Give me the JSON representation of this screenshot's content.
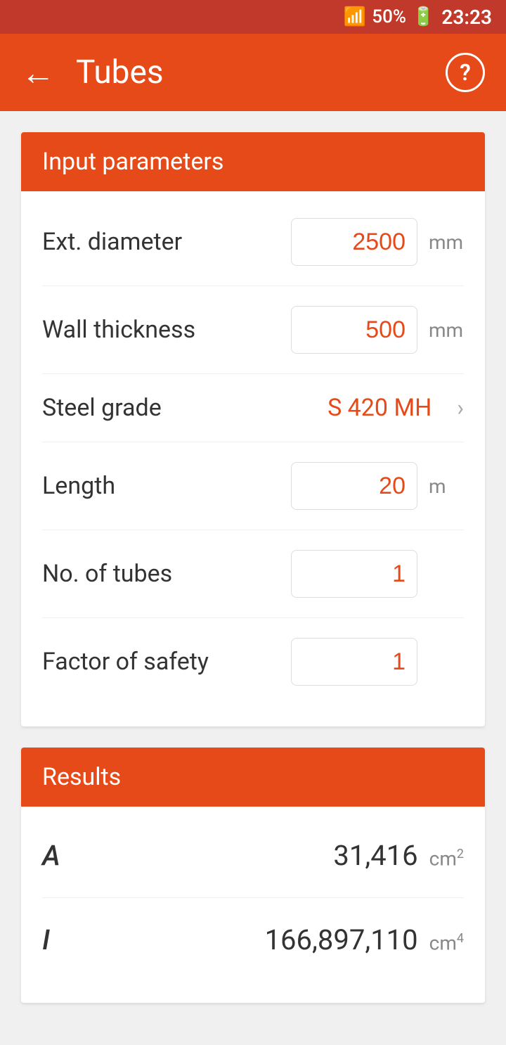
{
  "statusBar": {
    "battery": "50%",
    "time": "23:23",
    "batteryIcon": "🔋",
    "signalIcon": "📶"
  },
  "appBar": {
    "backIcon": "←",
    "title": "Tubes",
    "helpIcon": "?",
    "helpLabel": "?"
  },
  "inputSection": {
    "header": "Input parameters",
    "fields": [
      {
        "label": "Ext. diameter",
        "value": "2500",
        "unit": "mm",
        "type": "input",
        "name": "ext-diameter"
      },
      {
        "label": "Wall thickness",
        "value": "500",
        "unit": "mm",
        "type": "input",
        "name": "wall-thickness"
      },
      {
        "label": "Steel grade",
        "value": "S 420 MH",
        "unit": "",
        "type": "select",
        "name": "steel-grade"
      },
      {
        "label": "Length",
        "value": "20",
        "unit": "m",
        "type": "input",
        "name": "length"
      },
      {
        "label": "No. of tubes",
        "value": "1",
        "unit": "",
        "type": "input",
        "name": "no-of-tubes"
      },
      {
        "label": "Factor of safety",
        "value": "1",
        "unit": "",
        "type": "input",
        "name": "factor-of-safety"
      }
    ]
  },
  "resultsSection": {
    "header": "Results",
    "results": [
      {
        "label": "A",
        "value": "31,416",
        "unit": "cm",
        "unitSup": "2",
        "name": "result-a"
      },
      {
        "label": "I",
        "value": "166,897,110",
        "unit": "cm",
        "unitSup": "4",
        "name": "result-i"
      }
    ]
  }
}
